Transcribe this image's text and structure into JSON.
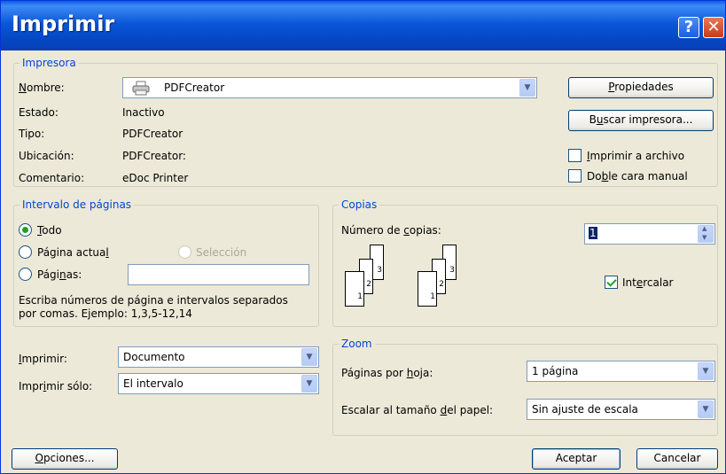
{
  "window": {
    "title": "Imprimir",
    "help_symbol": "?",
    "close_symbol": "✕"
  },
  "printer": {
    "group_title": "Impresora",
    "name_label_u": "N",
    "name_label_rest": "ombre:",
    "name_value": "PDFCreator",
    "status_label": "Estado:",
    "status_value": "Inactivo",
    "type_label": "Tipo:",
    "type_value": "PDFCreator",
    "location_label": "Ubicación:",
    "location_value": "PDFCreator:",
    "comment_label": "Comentario:",
    "comment_value": "eDoc Printer",
    "properties_u": "P",
    "properties_rest": "ropiedades",
    "find_pre": "B",
    "find_u": "u",
    "find_rest": "scar impresora...",
    "print_to_file_u": "I",
    "print_to_file_rest": "mprimir a archivo",
    "duplex_pre": "Do",
    "duplex_u": "b",
    "duplex_rest": "le cara manual"
  },
  "page_range": {
    "group_title": "Intervalo de páginas",
    "all_u": "T",
    "all_rest": "odo",
    "current_pre": "Página actua",
    "current_u": "l",
    "selection": "Selección",
    "pages_pre": "Pági",
    "pages_u": "n",
    "pages_rest": "as:",
    "pages_value": "",
    "hint_line1": "Escriba números de página e intervalos separados",
    "hint_line2": "por comas. Ejemplo: 1,3,5-12,14"
  },
  "copies": {
    "group_title": "Copias",
    "num_pre": "Número de ",
    "num_u": "c",
    "num_rest": "opias:",
    "num_value": "1",
    "collate_pre": "Int",
    "collate_u": "e",
    "collate_rest": "rcalar",
    "collate_checked": true,
    "page_nums": [
      "1",
      "2",
      "3"
    ]
  },
  "print_what": {
    "label_u": "I",
    "label_rest": "mprimir:",
    "value": "Documento",
    "only_pre": "Impr",
    "only_u": "i",
    "only_rest": "mir sólo:",
    "only_value": "El intervalo"
  },
  "zoom": {
    "group_title": "Zoom",
    "pps_pre": "Páginas por ",
    "pps_u": "h",
    "pps_rest": "oja:",
    "pps_value": "1 página",
    "scale_pre": "Escalar al tamaño ",
    "scale_u": "d",
    "scale_rest": "el papel:",
    "scale_value": "Sin ajuste de escala"
  },
  "buttons": {
    "options_u": "O",
    "options_rest": "pciones...",
    "ok": "Aceptar",
    "cancel": "Cancelar"
  },
  "arrow_down": "▼",
  "spin_up": "▲",
  "spin_down": "▼"
}
